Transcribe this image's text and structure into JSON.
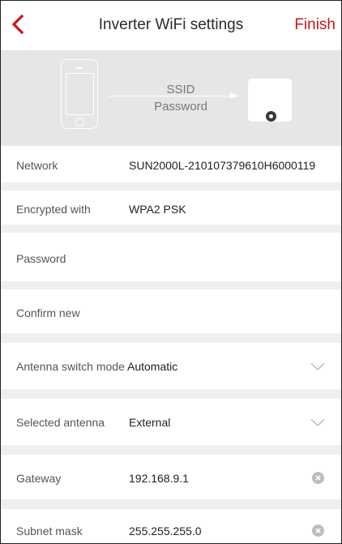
{
  "header": {
    "title": "Inverter WiFi settings",
    "finish_label": "Finish",
    "accent_color": "#c8161d"
  },
  "banner": {
    "ssid_label": "SSID",
    "password_label": "Password"
  },
  "form": {
    "network": {
      "label": "Network",
      "value": "SUN2000L-210107379610H6000119"
    },
    "encryption": {
      "label": "Encrypted with",
      "value": "WPA2 PSK"
    },
    "password": {
      "label": "Password",
      "value": ""
    },
    "confirm": {
      "label": "Confirm new",
      "value": ""
    },
    "antenna_mode": {
      "label": "Antenna switch mode",
      "value": "Automatic"
    },
    "selected_antenna": {
      "label": "Selected antenna",
      "value": "External"
    },
    "gateway": {
      "label": "Gateway",
      "value": "192.168.9.1"
    },
    "subnet": {
      "label": "Subnet mask",
      "value": "255.255.255.0"
    }
  },
  "icons": {
    "back": "back-chevron-icon",
    "dropdown": "chevron-down-icon",
    "clear": "clear-icon"
  }
}
